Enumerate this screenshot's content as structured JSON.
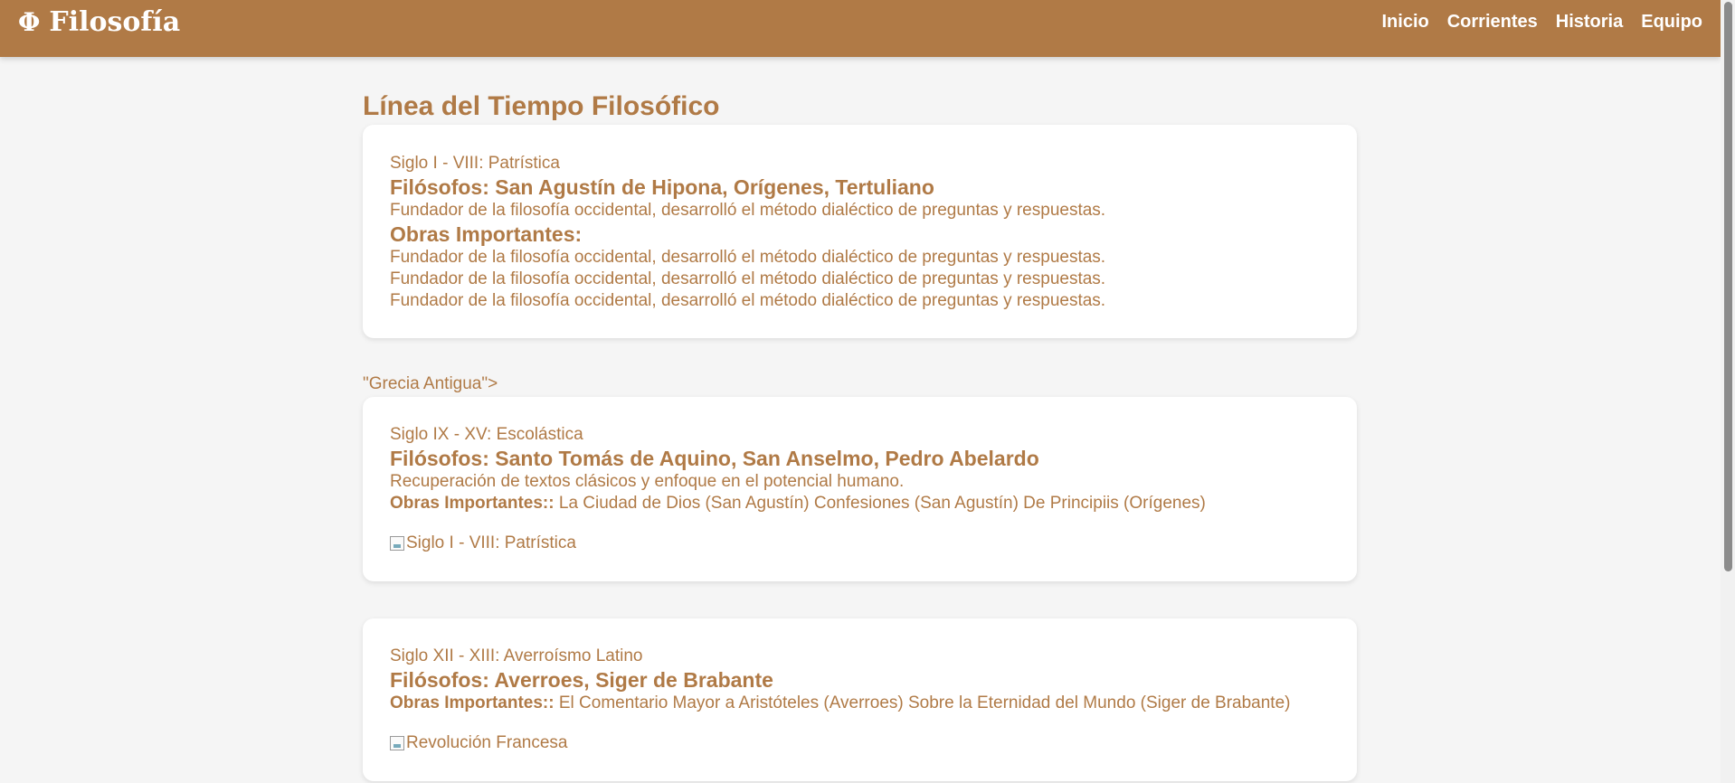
{
  "header": {
    "brand_symbol": "Φ",
    "brand_name": "Filosofía",
    "nav": [
      "Inicio",
      "Corrientes",
      "Historia",
      "Equipo"
    ]
  },
  "main": {
    "title": "Línea del Tiempo Filosófico",
    "stray_text": "\"Grecia Antigua\">",
    "cards": [
      {
        "era": "Siglo I - VIII: Patrística",
        "philosophers": "Filósofos: San Agustín de Hipona, Orígenes, Tertuliano",
        "description": "Fundador de la filosofía occidental, desarrolló el método dialéctico de preguntas y respuestas.",
        "works_heading": "Obras Importantes:",
        "works_lines": [
          "Fundador de la filosofía occidental, desarrolló el método dialéctico de preguntas y respuestas.",
          "Fundador de la filosofía occidental, desarrolló el método dialéctico de preguntas y respuestas.",
          "Fundador de la filosofía occidental, desarrolló el método dialéctico de preguntas y respuestas."
        ]
      },
      {
        "era": "Siglo IX - XV: Escolástica",
        "philosophers": "Filósofos: Santo Tomás de Aquino, San Anselmo, Pedro Abelardo",
        "description": "Recuperación de textos clásicos y enfoque en el potencial humano.",
        "works_label": "Obras Importantes::",
        "works_text": "La Ciudad de Dios (San Agustín) Confesiones (San Agustín) De Principiis (Orígenes)",
        "image_alt": "Siglo I - VIII: Patrística"
      },
      {
        "era": "Siglo XII - XIII: Averroísmo Latino",
        "philosophers": "Filósofos: Averroes, Siger de Brabante",
        "works_label": "Obras Importantes::",
        "works_text": "El Comentario Mayor a Aristóteles (Averroes) Sobre la Eternidad del Mundo (Siger de Brabante)",
        "image_alt": "Revolución Francesa"
      }
    ]
  },
  "colors": {
    "accent": "#b07a46",
    "background": "#f5f5f5",
    "card": "#ffffff"
  }
}
